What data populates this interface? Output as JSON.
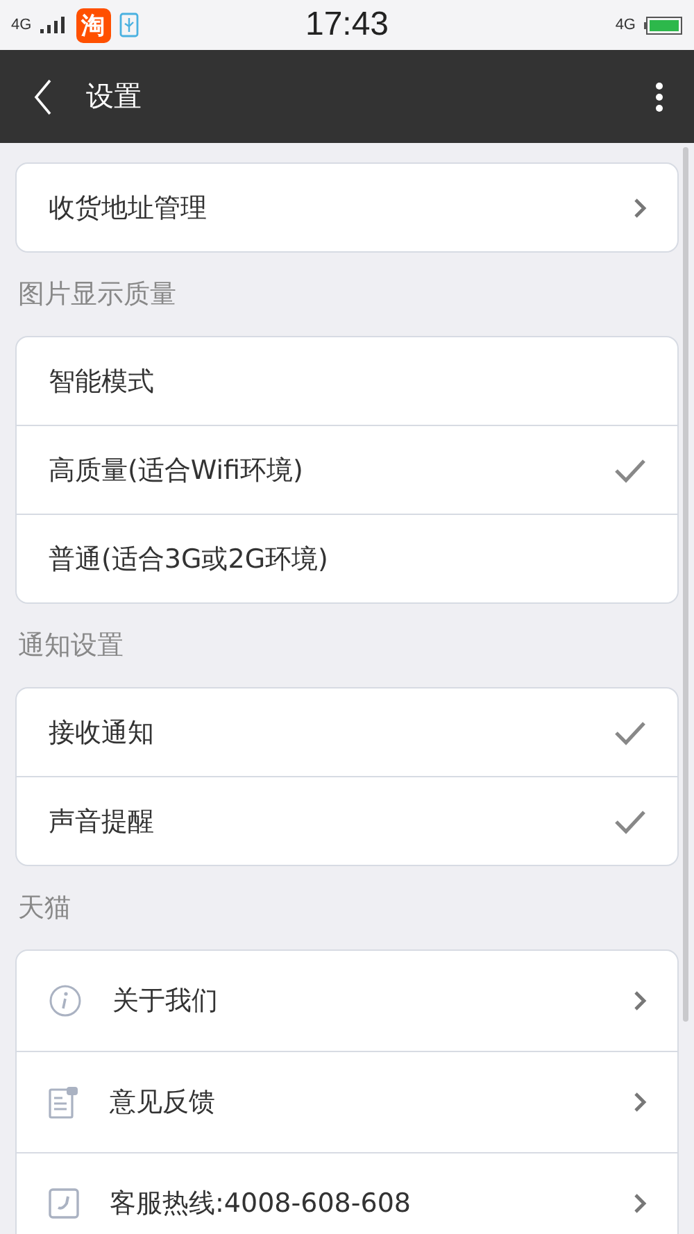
{
  "status_bar": {
    "network_left": "4G",
    "app_badge": "淘",
    "time": "17:43",
    "network_right": "4G"
  },
  "title_bar": {
    "title": "设置"
  },
  "sections": [
    {
      "kind": "plain",
      "rows": [
        {
          "label": "收货地址管理",
          "kind": "link"
        }
      ]
    },
    {
      "kind": "plain",
      "header": "图片显示质量",
      "rows": [
        {
          "label": "智能模式",
          "kind": "choice",
          "selected": false
        },
        {
          "label": "高质量(适合Wifi环境)",
          "kind": "choice",
          "selected": true
        },
        {
          "label": "普通(适合3G或2G环境)",
          "kind": "choice",
          "selected": false
        }
      ]
    },
    {
      "kind": "plain",
      "header": "通知设置",
      "rows": [
        {
          "label": "接收通知",
          "kind": "toggle",
          "checked": true
        },
        {
          "label": "声音提醒",
          "kind": "toggle",
          "checked": true
        }
      ]
    },
    {
      "kind": "icons",
      "header": "天猫",
      "rows": [
        {
          "label": "关于我们",
          "kind": "link"
        },
        {
          "label": "意见反馈",
          "kind": "link"
        },
        {
          "label": "客服热线:4008-608-608",
          "kind": "link"
        }
      ]
    }
  ]
}
